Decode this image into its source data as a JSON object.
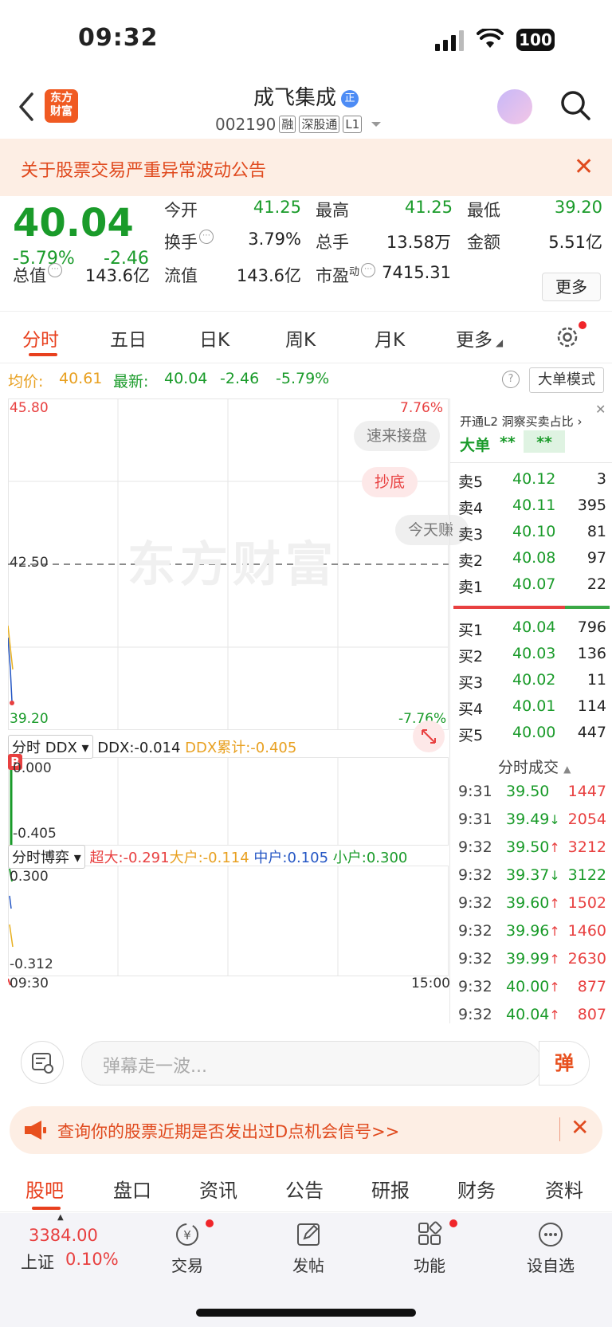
{
  "status": {
    "time": "09:32",
    "battery": "100"
  },
  "header": {
    "logo": "东方财富",
    "name": "成飞集成",
    "name_badge": "正",
    "code": "002190",
    "tags": [
      "融",
      "深股通",
      "L1"
    ]
  },
  "notice": {
    "text": "关于股票交易严重异常波动公告"
  },
  "quote": {
    "price": "40.04",
    "change_pct": "-5.79%",
    "change": "-2.46",
    "fields": [
      {
        "label": "今开",
        "value": "41.25",
        "color": "#1a9b2a"
      },
      {
        "label": "最高",
        "value": "41.25",
        "color": "#1a9b2a"
      },
      {
        "label": "最低",
        "value": "39.20",
        "color": "#1a9b2a"
      },
      {
        "label": "换手",
        "value": "3.79%",
        "color": "#222222"
      },
      {
        "label": "总手",
        "value": "13.58万",
        "color": "#222222"
      },
      {
        "label": "金额",
        "value": "5.51亿",
        "color": "#222222"
      },
      {
        "label": "总值",
        "value": "143.6亿",
        "color": "#222222"
      },
      {
        "label": "流值",
        "value": "143.6亿",
        "color": "#222222"
      },
      {
        "label": "市盈",
        "label_sup": "动",
        "value": "7415.31",
        "color": "#222222"
      }
    ],
    "more": "更多"
  },
  "tabs": [
    "分时",
    "五日",
    "日K",
    "周K",
    "月K",
    "更多"
  ],
  "infoline": {
    "avg_label": "均价:",
    "avg_value": "40.61",
    "latest_label": "最新:",
    "latest_value": "40.04",
    "latest_change": "-2.46",
    "latest_pct": "-5.79%",
    "help": "?",
    "big_mode": "大单模式"
  },
  "chart": {
    "y_high": "45.80",
    "y_mid": "42.50",
    "y_low": "39.20",
    "pct_high": "7.76%",
    "pct_low": "-7.76%",
    "watermark": "东方财富",
    "pills": [
      "速来接盘",
      "抄底",
      "今天赚"
    ],
    "ddx": {
      "selector": "分时 DDX",
      "value": "DDX:-0.014",
      "cum": "DDX累计:-0.405",
      "top": "0.000",
      "bottom": "-0.405",
      "marker": "B"
    },
    "game": {
      "selector": "分时博弈",
      "super": "超大:-0.291",
      "large": "大户:-0.114",
      "mid": "中户:0.105",
      "small": "小户:0.300",
      "top": "0.300",
      "bottom": "-0.312"
    },
    "time_start": "09:30",
    "time_end": "15:00"
  },
  "book": {
    "promo": "开通L2 洞察买卖占比",
    "big_label": "大单",
    "big_v1": "**",
    "big_v2": "**",
    "sells": [
      {
        "label": "卖5",
        "price": "40.12",
        "vol": "3"
      },
      {
        "label": "卖4",
        "price": "40.11",
        "vol": "395"
      },
      {
        "label": "卖3",
        "price": "40.10",
        "vol": "81"
      },
      {
        "label": "卖2",
        "price": "40.08",
        "vol": "97"
      },
      {
        "label": "卖1",
        "price": "40.07",
        "vol": "22"
      }
    ],
    "buys": [
      {
        "label": "买1",
        "price": "40.04",
        "vol": "796"
      },
      {
        "label": "买2",
        "price": "40.03",
        "vol": "136"
      },
      {
        "label": "买3",
        "price": "40.02",
        "vol": "11"
      },
      {
        "label": "买4",
        "price": "40.01",
        "vol": "114"
      },
      {
        "label": "买5",
        "price": "40.00",
        "vol": "447"
      }
    ],
    "ticks_title": "分时成交",
    "ticks": [
      {
        "time": "9:31",
        "price": "39.50",
        "arrow": "",
        "vol": "1447",
        "vol_color": "#e84040"
      },
      {
        "time": "9:31",
        "price": "39.49",
        "arrow": "↓",
        "vol": "2054",
        "vol_color": "#e84040"
      },
      {
        "time": "9:32",
        "price": "39.50",
        "arrow": "↑",
        "vol": "3212",
        "vol_color": "#e84040"
      },
      {
        "time": "9:32",
        "price": "39.37",
        "arrow": "↓",
        "vol": "3122",
        "vol_color": "#1a9b2a"
      },
      {
        "time": "9:32",
        "price": "39.60",
        "arrow": "↑",
        "vol": "1502",
        "vol_color": "#e84040"
      },
      {
        "time": "9:32",
        "price": "39.96",
        "arrow": "↑",
        "vol": "1460",
        "vol_color": "#e84040"
      },
      {
        "time": "9:32",
        "price": "39.99",
        "arrow": "↑",
        "vol": "2630",
        "vol_color": "#e84040"
      },
      {
        "time": "9:32",
        "price": "40.00",
        "arrow": "↑",
        "vol": "877",
        "vol_color": "#e84040"
      },
      {
        "time": "9:32",
        "price": "40.04",
        "arrow": "↑",
        "vol": "807",
        "vol_color": "#e84040"
      }
    ]
  },
  "comment": {
    "placeholder": "弹幕走一波...",
    "send": "弹"
  },
  "banner": {
    "text": "查询你的股票近期是否发出过D点机会信号>>"
  },
  "bottom_tabs": [
    "股吧",
    "盘口",
    "资讯",
    "公告",
    "研报",
    "财务",
    "资料"
  ],
  "bottom_bar": {
    "index_value": "3384.00",
    "index_name": "上证",
    "index_pct": "0.10%",
    "items": [
      "交易",
      "发帖",
      "功能",
      "设自选"
    ]
  }
}
